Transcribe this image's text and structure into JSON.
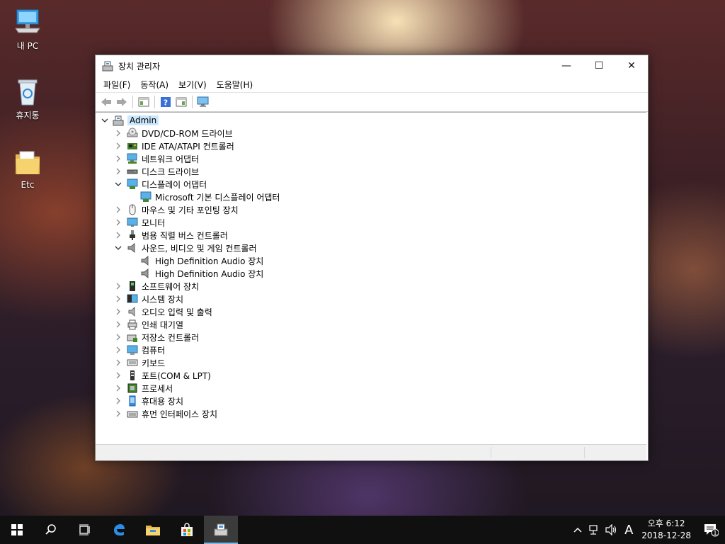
{
  "desktop": {
    "icons": [
      {
        "label": "내 PC"
      },
      {
        "label": "휴지통"
      },
      {
        "label": "Etc"
      }
    ]
  },
  "window": {
    "title": "장치 관리자",
    "controls": {
      "minimize": "—",
      "maximize": "☐",
      "close": "✕"
    },
    "menu": [
      "파일(F)",
      "동작(A)",
      "보기(V)",
      "도움말(H)"
    ]
  },
  "tree": {
    "root": "Admin",
    "items": [
      "DVD/CD-ROM 드라이브",
      "IDE ATA/ATAPI 컨트롤러",
      "네트워크 어댑터",
      "디스크 드라이브",
      "디스플레이 어댑터",
      "Microsoft 기본 디스플레이 어댑터",
      "마우스 및 기타 포인팅 장치",
      "모니터",
      "범용 직렬 버스 컨트롤러",
      "사운드, 비디오 및 게임 컨트롤러",
      "High Definition Audio 장치",
      "High Definition Audio 장치",
      "소프트웨어 장치",
      "시스템 장치",
      "오디오 입력 및 출력",
      "인쇄 대기열",
      "저장소 컨트롤러",
      "컴퓨터",
      "키보드",
      "포트(COM & LPT)",
      "프로세서",
      "휴대용 장치",
      "휴먼 인터페이스 장치"
    ],
    "expanded": [
      "디스플레이 어댑터",
      "사운드, 비디오 및 게임 컨트롤러"
    ]
  },
  "taskbar": {
    "tray": {
      "ime": "A",
      "notifications_count": "1"
    },
    "clock": {
      "time": "오후 6:12",
      "date": "2018-12-28"
    }
  },
  "colors": {
    "selection": "#cce8ff",
    "taskbar": "#101010",
    "accent": "#76b9ed"
  }
}
